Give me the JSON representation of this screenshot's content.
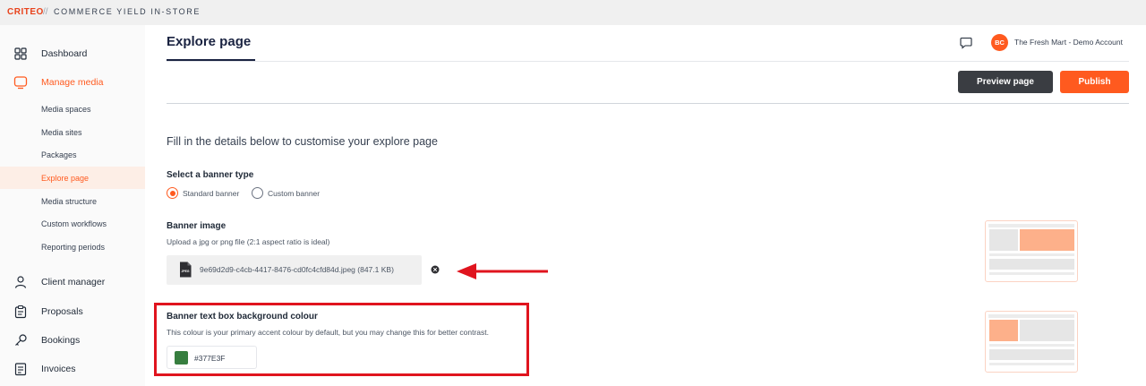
{
  "brand": {
    "logo": "CRITEO",
    "separator": "//",
    "product": "COMMERCE YIELD IN-STORE"
  },
  "sidebar": {
    "items": [
      {
        "label": "Dashboard",
        "icon": "grid-icon"
      },
      {
        "label": "Manage media",
        "icon": "monitor-icon",
        "active": true
      },
      {
        "label": "Client manager",
        "icon": "user-icon"
      },
      {
        "label": "Proposals",
        "icon": "clipboard-icon"
      },
      {
        "label": "Bookings",
        "icon": "key-icon"
      },
      {
        "label": "Invoices",
        "icon": "receipt-icon"
      }
    ],
    "sub_items": [
      {
        "label": "Media spaces"
      },
      {
        "label": "Media sites"
      },
      {
        "label": "Packages"
      },
      {
        "label": "Explore page",
        "selected": true
      },
      {
        "label": "Media structure"
      },
      {
        "label": "Custom workflows"
      },
      {
        "label": "Reporting periods"
      }
    ]
  },
  "header": {
    "title": "Explore page",
    "account": {
      "initials": "BC",
      "name": "The Fresh Mart - Demo Account"
    }
  },
  "actions": {
    "preview_label": "Preview page",
    "publish_label": "Publish"
  },
  "form": {
    "intro": "Fill in the details below to customise your explore page",
    "banner_type": {
      "label": "Select a banner type",
      "options": [
        {
          "label": "Standard banner",
          "selected": true
        },
        {
          "label": "Custom banner",
          "selected": false
        }
      ]
    },
    "banner_image": {
      "label": "Banner image",
      "help": "Upload a jpg or png file (2:1 aspect ratio is ideal)",
      "file_name": "9e69d2d9-c4cb-4417-8476-cd0fc4cfd84d.jpeg (847.1 KB)",
      "file_icon_text": "JPEG"
    },
    "background_colour": {
      "label": "Banner text box background colour",
      "help": "This colour is your primary accent colour by default, but you may change this for better contrast.",
      "value": "#377E3F"
    }
  },
  "colors": {
    "accent": "#ff5a1f",
    "navy": "#1a2341",
    "swatch": "#377E3F",
    "annotation": "#e0141e"
  }
}
